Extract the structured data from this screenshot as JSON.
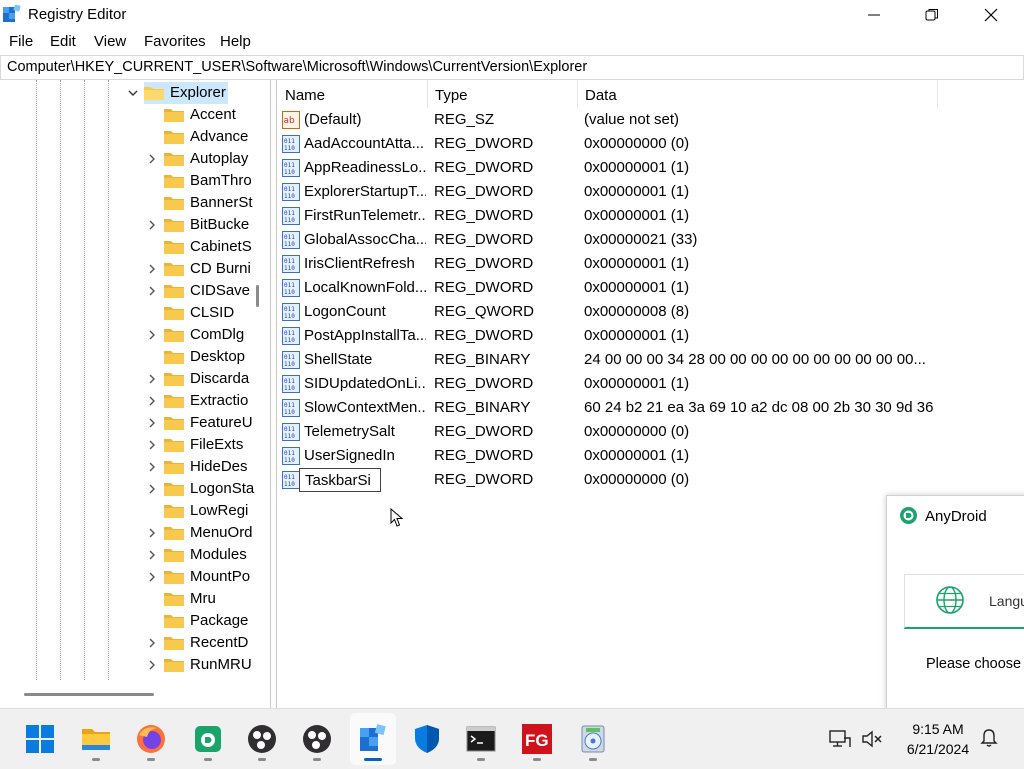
{
  "window": {
    "title": "Registry Editor"
  },
  "menu": [
    "File",
    "Edit",
    "View",
    "Favorites",
    "Help"
  ],
  "address": "Computer\\HKEY_CURRENT_USER\\Software\\Microsoft\\Windows\\CurrentVersion\\Explorer",
  "tree": {
    "selected": "Explorer",
    "children": [
      "Accent",
      "Advance",
      "Autoplay",
      "BamThro",
      "BannerSt",
      "BitBucke",
      "CabinetS",
      "CD Burni",
      "CIDSave",
      "CLSID",
      "ComDlg",
      "Desktop",
      "Discarda",
      "Extractio",
      "FeatureU",
      "FileExts",
      "HideDes",
      "LogonSta",
      "LowRegi",
      "MenuOrd",
      "Modules",
      "MountPo",
      "Mru",
      "Package",
      "RecentD",
      "RunMRU"
    ]
  },
  "columns": {
    "name": "Name",
    "type": "Type",
    "data": "Data"
  },
  "values": [
    {
      "name": "(Default)",
      "type": "REG_SZ",
      "data": "(value not set)",
      "icon": "string-value-icon"
    },
    {
      "name": "AadAccountAtta...",
      "type": "REG_DWORD",
      "data": "0x00000000 (0)",
      "icon": "binary-value-icon"
    },
    {
      "name": "AppReadinessLo...",
      "type": "REG_DWORD",
      "data": "0x00000001 (1)",
      "icon": "binary-value-icon"
    },
    {
      "name": "ExplorerStartupT...",
      "type": "REG_DWORD",
      "data": "0x00000001 (1)",
      "icon": "binary-value-icon"
    },
    {
      "name": "FirstRunTelemetr...",
      "type": "REG_DWORD",
      "data": "0x00000001 (1)",
      "icon": "binary-value-icon"
    },
    {
      "name": "GlobalAssocCha...",
      "type": "REG_DWORD",
      "data": "0x00000021 (33)",
      "icon": "binary-value-icon"
    },
    {
      "name": "IrisClientRefresh",
      "type": "REG_DWORD",
      "data": "0x00000001 (1)",
      "icon": "binary-value-icon"
    },
    {
      "name": "LocalKnownFold...",
      "type": "REG_DWORD",
      "data": "0x00000001 (1)",
      "icon": "binary-value-icon"
    },
    {
      "name": "LogonCount",
      "type": "REG_QWORD",
      "data": "0x00000008 (8)",
      "icon": "binary-value-icon"
    },
    {
      "name": "PostAppInstallTa...",
      "type": "REG_DWORD",
      "data": "0x00000001 (1)",
      "icon": "binary-value-icon"
    },
    {
      "name": "ShellState",
      "type": "REG_BINARY",
      "data": "24 00 00 00 34 28 00 00 00 00 00 00 00 00 00 00...",
      "icon": "binary-value-icon"
    },
    {
      "name": "SIDUpdatedOnLi...",
      "type": "REG_DWORD",
      "data": "0x00000001 (1)",
      "icon": "binary-value-icon"
    },
    {
      "name": "SlowContextMen...",
      "type": "REG_BINARY",
      "data": "60 24 b2 21 ea 3a 69 10 a2 dc 08 00 2b 30 30 9d 36...",
      "icon": "binary-value-icon"
    },
    {
      "name": "TelemetrySalt",
      "type": "REG_DWORD",
      "data": "0x00000000 (0)",
      "icon": "binary-value-icon"
    },
    {
      "name": "UserSignedIn",
      "type": "REG_DWORD",
      "data": "0x00000001 (1)",
      "icon": "binary-value-icon"
    }
  ],
  "editing_row": {
    "name": "TaskbarSi",
    "type": "REG_DWORD",
    "data": "0x00000000 (0)"
  },
  "popup": {
    "title": "AnyDroid",
    "lang_label": "Langu",
    "prompt": "Please choose"
  },
  "taskbar": {
    "time": "9:15 AM",
    "date": "6/21/2024"
  },
  "colors": {
    "accent": "#0067c0",
    "selection": "#cce8ff",
    "folder": "#f8c94c",
    "anydroid": "#1aa36b"
  }
}
